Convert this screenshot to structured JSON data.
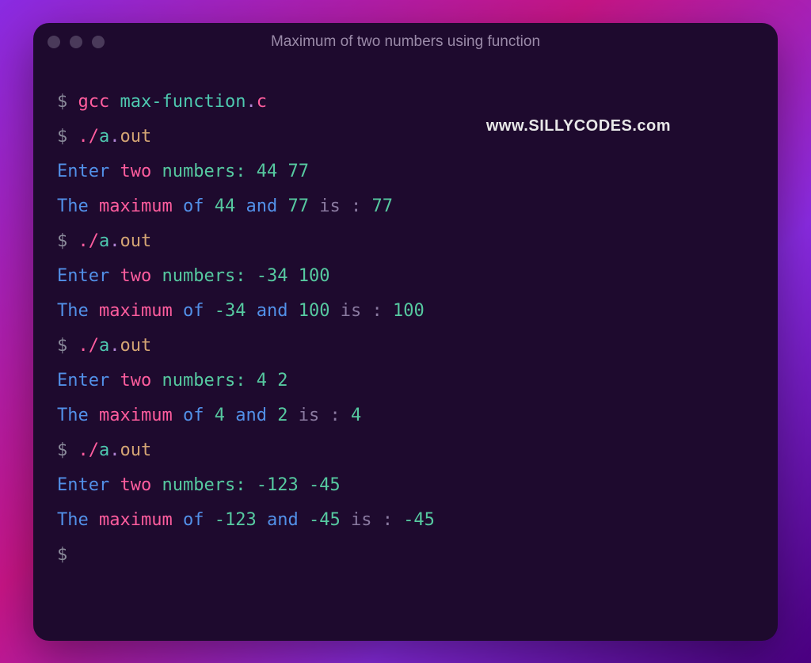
{
  "window": {
    "title": "Maximum of two numbers using function"
  },
  "watermark": "www.SILLYCODES.com",
  "terminal": {
    "prompt": "$",
    "compile": {
      "cmd": "gcc",
      "file_base": "max-function",
      "file_ext": "c"
    },
    "run": {
      "dotslash": "./",
      "exe_base": "a",
      "exe_ext": "out"
    },
    "labels": {
      "enter": "Enter",
      "two": "two",
      "numbers_colon": "numbers:",
      "the": "The",
      "maximum": "maximum",
      "of": "of",
      "and": "and",
      "is_colon": "is :"
    },
    "runs": [
      {
        "a": "44",
        "b": "77",
        "max": "77"
      },
      {
        "a": "-34",
        "b": "100",
        "max": "100"
      },
      {
        "a": "4",
        "b": "2",
        "max": "4"
      },
      {
        "a": "-123",
        "b": "-45",
        "max": "-45"
      }
    ]
  }
}
